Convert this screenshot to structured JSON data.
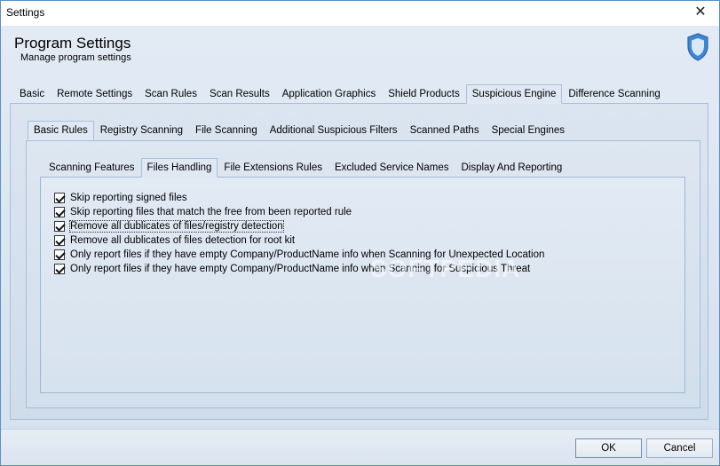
{
  "window": {
    "title": "Settings"
  },
  "header": {
    "title": "Program Settings",
    "subtitle": "Manage program settings"
  },
  "main_tabs": [
    {
      "label": "Basic",
      "active": false
    },
    {
      "label": "Remote Settings",
      "active": false
    },
    {
      "label": "Scan Rules",
      "active": false
    },
    {
      "label": "Scan Results",
      "active": false
    },
    {
      "label": "Application Graphics",
      "active": false
    },
    {
      "label": "Shield Products",
      "active": false
    },
    {
      "label": "Suspicious Engine",
      "active": true
    },
    {
      "label": "Difference Scanning",
      "active": false
    }
  ],
  "sub_tabs": [
    {
      "label": "Basic Rules",
      "active": true
    },
    {
      "label": "Registry Scanning",
      "active": false
    },
    {
      "label": "File Scanning",
      "active": false
    },
    {
      "label": "Additional Suspicious Filters",
      "active": false
    },
    {
      "label": "Scanned Paths",
      "active": false
    },
    {
      "label": "Special Engines",
      "active": false
    }
  ],
  "inner_tabs": [
    {
      "label": "Scanning Features",
      "active": false
    },
    {
      "label": "Files Handling",
      "active": true
    },
    {
      "label": "File Extensions Rules",
      "active": false
    },
    {
      "label": "Excluded Service Names",
      "active": false
    },
    {
      "label": "Display And Reporting",
      "active": false
    }
  ],
  "options": [
    {
      "label": "Skip reporting signed files",
      "checked": true
    },
    {
      "label": "Skip reporting files that match the free from been reported rule",
      "checked": true
    },
    {
      "label": "Remove all dublicates of files/registry detection",
      "checked": true
    },
    {
      "label": "Remove all dublicates of files detection for root kit",
      "checked": true
    },
    {
      "label": "Only report files if they have empty Company/ProductName info when Scanning for Unexpected Location",
      "checked": true
    },
    {
      "label": "Only report files if they have empty Company/ProductName info when Scanning for Suspicious Threat",
      "checked": true
    }
  ],
  "watermark": "SOFTPEDIA",
  "footer": {
    "ok_label": "OK",
    "cancel_label": "Cancel"
  },
  "icons": {
    "close": "close-icon",
    "logo": "shield-icon"
  },
  "colors": {
    "accent": "#5b8fc7",
    "shield": "#3f86d8"
  }
}
